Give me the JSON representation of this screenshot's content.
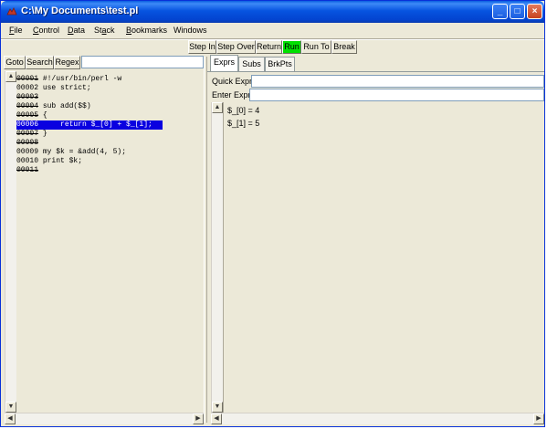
{
  "window": {
    "title": "C:\\My Documents\\test.pl",
    "controls": [
      "_",
      "□",
      "×"
    ]
  },
  "menu": [
    {
      "label": "File",
      "ul": "F",
      "rest": "ile"
    },
    {
      "label": "Control",
      "ul": "C",
      "rest": "ontrol"
    },
    {
      "label": "Data",
      "ul": "D",
      "rest": "ata"
    },
    {
      "label": "Stack",
      "ul_mid": true,
      "pre": "St",
      "ul": "a",
      "rest": "ck"
    },
    {
      "label": "Bookmarks",
      "ul": "B",
      "rest": "ookmarks"
    },
    {
      "label": "Windows"
    }
  ],
  "toolbar": {
    "step_in": "Step In",
    "step_over": "Step Over",
    "return": "Return",
    "run": "Run",
    "run_to": "Run To",
    "break": "Break",
    "run_color": "#00e000"
  },
  "search": {
    "goto": "Goto",
    "search": "Search",
    "regex": "Regex",
    "value": ""
  },
  "code": {
    "lines": [
      {
        "num": "00001",
        "text": " #!/usr/bin/perl -w",
        "strike": true
      },
      {
        "num": "00002",
        "text": " use strict;",
        "strike": false
      },
      {
        "num": "00003",
        "text": "",
        "strike": true
      },
      {
        "num": "00004",
        "text": " sub add($$)",
        "strike": true
      },
      {
        "num": "00005",
        "text": " {",
        "strike": true
      },
      {
        "num": "00006",
        "text": "     return $_[0] + $_[1];",
        "strike": false,
        "selected": true
      },
      {
        "num": "00007",
        "text": " }",
        "strike": true
      },
      {
        "num": "00008",
        "text": "",
        "strike": true
      },
      {
        "num": "00009",
        "text": " my $k = &add(4, 5);",
        "strike": false
      },
      {
        "num": "00010",
        "text": " print $k;",
        "strike": false
      },
      {
        "num": "00011",
        "text": "",
        "strike": true
      }
    ],
    "selection_color": "#0a00e0"
  },
  "tabs": [
    "Exprs",
    "Subs",
    "BrkPts"
  ],
  "exprs": {
    "quick_label": "Quick Expr:",
    "enter_label": "Enter Expr:",
    "quick_value": "",
    "enter_value": "",
    "watches": [
      "$_[0] = 4",
      "$_[1] = 5"
    ]
  }
}
